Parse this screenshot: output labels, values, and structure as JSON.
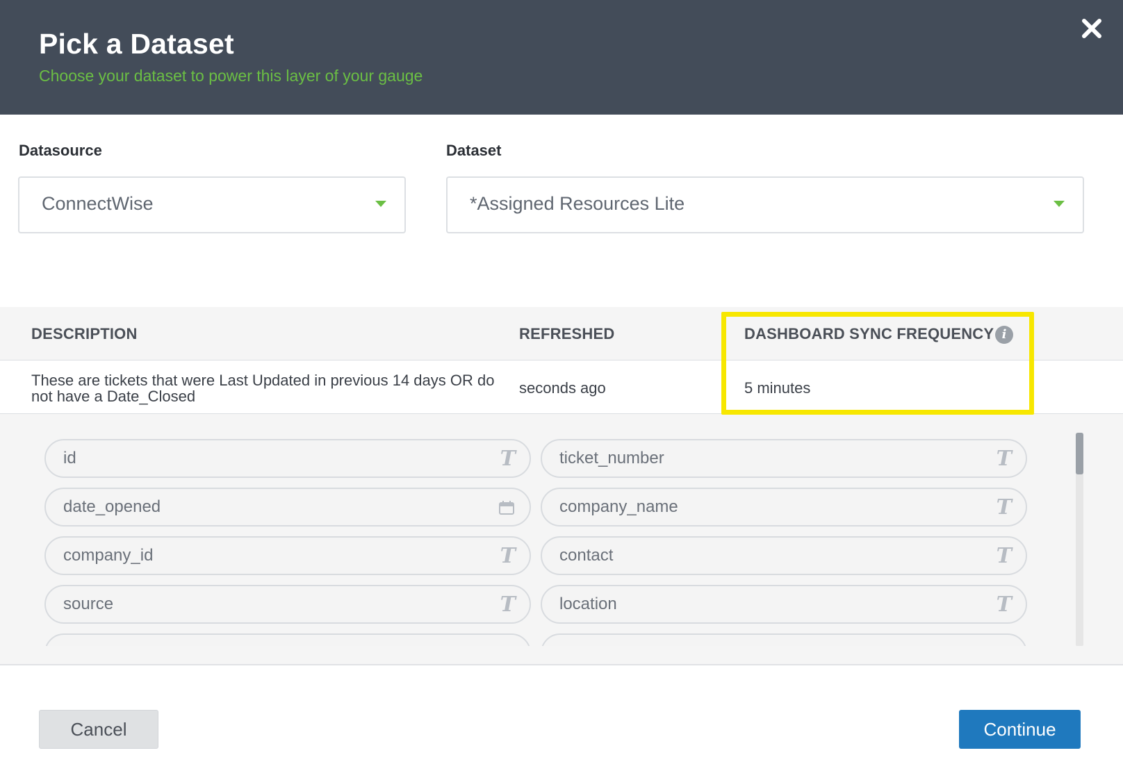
{
  "dialog": {
    "title": "Pick a Dataset",
    "subtitle": "Choose your dataset to power this layer of your gauge",
    "close_icon": "close-icon"
  },
  "datasource": {
    "label": "Datasource",
    "value": "ConnectWise"
  },
  "dataset": {
    "label": "Dataset",
    "value": "*Assigned Resources Lite"
  },
  "info_table": {
    "headers": {
      "description": "DESCRIPTION",
      "refreshed": "REFRESHED",
      "sync_frequency": "DASHBOARD SYNC FREQUENCY"
    },
    "row": {
      "description": "These are tickets that were Last Updated in previous 14 days OR do not have a Date_Closed",
      "refreshed": "seconds ago",
      "sync_frequency": "5 minutes"
    }
  },
  "fields": [
    {
      "name": "id",
      "type": "text"
    },
    {
      "name": "ticket_number",
      "type": "text"
    },
    {
      "name": "date_opened",
      "type": "date"
    },
    {
      "name": "company_name",
      "type": "text"
    },
    {
      "name": "company_id",
      "type": "text"
    },
    {
      "name": "contact",
      "type": "text"
    },
    {
      "name": "source",
      "type": "text"
    },
    {
      "name": "location",
      "type": "text"
    },
    {
      "name": "",
      "type": "date"
    },
    {
      "name": "",
      "type": "date"
    }
  ],
  "footer": {
    "cancel_label": "Cancel",
    "continue_label": "Continue"
  },
  "colors": {
    "header_bg": "#434c59",
    "subtitle": "#6bbf44",
    "accent_caret": "#6bbf44",
    "highlight": "#f7e700",
    "primary_button": "#1f79be"
  }
}
